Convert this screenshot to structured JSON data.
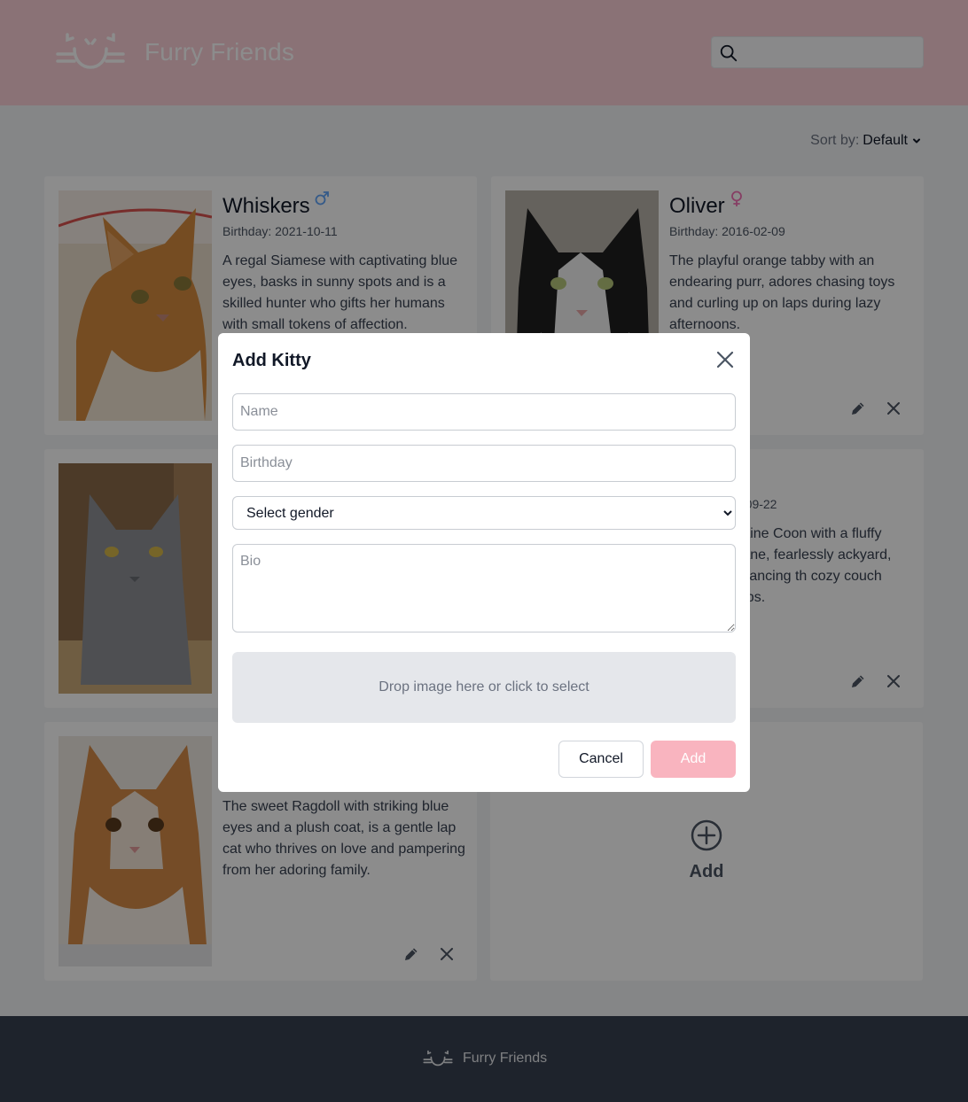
{
  "header": {
    "brand": "Furry Friends",
    "search": {
      "value": "",
      "placeholder": ""
    },
    "logo_icon": "cat-face-icon",
    "search_icon": "search-icon"
  },
  "sort": {
    "label": "Sort by:",
    "value": "Default"
  },
  "cats": [
    {
      "name": "Whiskers",
      "gender": "male",
      "birthday": "Birthday: 2021-10-11",
      "bio": "A regal Siamese with captivating blue eyes, basks in sunny spots and is a skilled hunter who gifts her humans with small tokens of affection."
    },
    {
      "name": "Oliver",
      "gender": "female",
      "birthday": "Birthday: 2016-02-09",
      "bio": "The playful orange tabby with an endearing purr, adores chasing toys and curling up on laps during lazy afternoons."
    },
    {
      "name": "",
      "gender": "",
      "birthday": "",
      "bio": ""
    },
    {
      "name": "",
      "gender": "",
      "birthday": "-09-22",
      "bio": "Maine Coon with a fluffy mane, fearlessly ackyard, balancing th cozy couch naps."
    },
    {
      "name": "",
      "gender": "",
      "birthday": "",
      "bio": "The sweet Ragdoll with striking blue eyes and a plush coat, is a gentle lap cat who thrives on love and pampering from her adoring family."
    }
  ],
  "add_card": {
    "label": "Add"
  },
  "footer": {
    "brand": "Furry Friends"
  },
  "modal": {
    "title": "Add Kitty",
    "name_placeholder": "Name",
    "birthday_placeholder": "Birthday",
    "gender_select": "Select gender",
    "bio_placeholder": "Bio",
    "dropzone": "Drop image here or click to select",
    "cancel": "Cancel",
    "add": "Add"
  },
  "colors": {
    "header_bg": "#fbcfd8",
    "accent_pink": "#f9b4bf",
    "male_icon": "#60a5fa",
    "female_icon": "#f472b6",
    "footer_bg": "#374151"
  }
}
